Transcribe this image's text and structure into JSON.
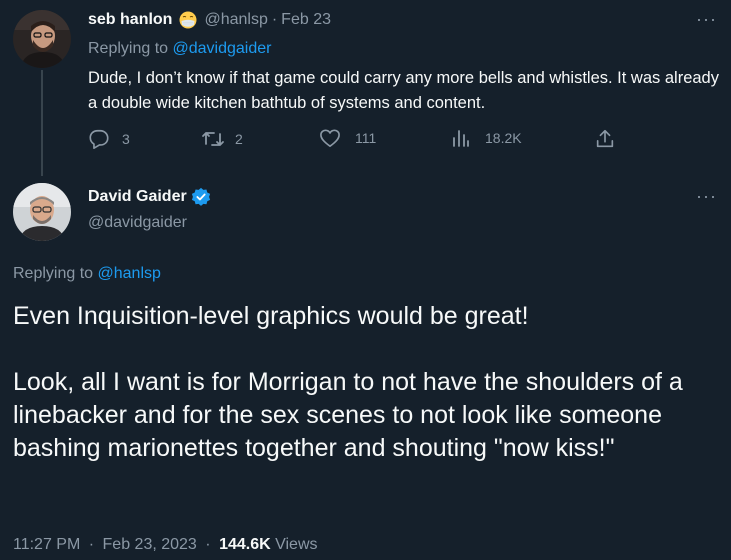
{
  "reply": {
    "author_name": "seb hanlon",
    "emoji": "😷",
    "handle": "@hanlsp",
    "separator": "·",
    "date": "Feb 23",
    "replying_prefix": "Replying to ",
    "replying_mention": "@davidgaider",
    "body": "Dude, I don’t know if that game could carry any more bells and whistles. It was already a double wide kitchen bathtub of systems and content.",
    "more": "···",
    "actions": {
      "replies": "3",
      "retweets": "2",
      "likes": "111",
      "views": "18.2K"
    }
  },
  "main": {
    "author_name": "David Gaider",
    "handle": "@davidgaider",
    "more": "···",
    "replying_prefix": "Replying to ",
    "replying_mention": "@hanlsp",
    "text_line1": "Even Inquisition-level graphics would be great!",
    "text_para2": "Look, all I want is for Morrigan to not have the shoulders of a linebacker and for the sex scenes to not look like someone bashing marionettes together and shouting \"now kiss!\"",
    "time": "11:27 PM",
    "separator": "·",
    "date": "Feb 23, 2023",
    "views_count": "144.6K",
    "views_label": " Views"
  },
  "colors": {
    "background": "#15202b",
    "text": "#f7f9f9",
    "muted": "#8b98a5",
    "accent": "#1d9bf0"
  }
}
